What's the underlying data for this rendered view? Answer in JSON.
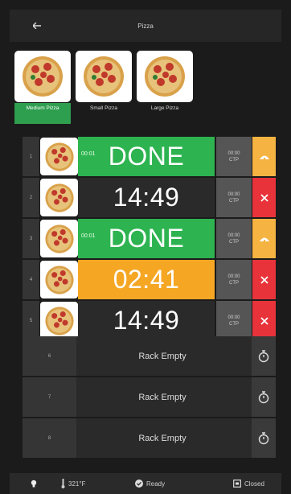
{
  "header": {
    "title": "Pizza"
  },
  "products": [
    {
      "label": "Medium Pizza",
      "selected": true
    },
    {
      "label": "Small Pizza",
      "selected": false
    },
    {
      "label": "Large Pizza",
      "selected": false
    }
  ],
  "racks": [
    {
      "slot": "1",
      "sub": "00:01",
      "main": "DONE",
      "state": "done",
      "ctp_time": "00:00",
      "ctp_label": "CTP",
      "action": "alert"
    },
    {
      "slot": "2",
      "sub": "",
      "main": "14:49",
      "state": "timing",
      "ctp_time": "00:00",
      "ctp_label": "CTP",
      "action": "cancel"
    },
    {
      "slot": "3",
      "sub": "00:01",
      "main": "DONE",
      "state": "done",
      "ctp_time": "00:00",
      "ctp_label": "CTP",
      "action": "alert"
    },
    {
      "slot": "4",
      "sub": "",
      "main": "02:41",
      "state": "warn",
      "ctp_time": "00:00",
      "ctp_label": "CTP",
      "action": "cancel"
    },
    {
      "slot": "5",
      "sub": "",
      "main": "14:49",
      "state": "timing",
      "ctp_time": "00:00",
      "ctp_label": "CTP",
      "action": "cancel"
    }
  ],
  "empty_racks": [
    {
      "slot": "6",
      "label": "Rack Empty"
    },
    {
      "slot": "7",
      "label": "Rack Empty"
    },
    {
      "slot": "8",
      "label": "Rack Empty"
    }
  ],
  "status_bar": {
    "temperature": "321°F",
    "status": "Ready",
    "door": "Closed"
  },
  "colors": {
    "done": "#2db350",
    "warn": "#f5a623",
    "cancel": "#e8333b",
    "selected": "#2e9e4f"
  }
}
